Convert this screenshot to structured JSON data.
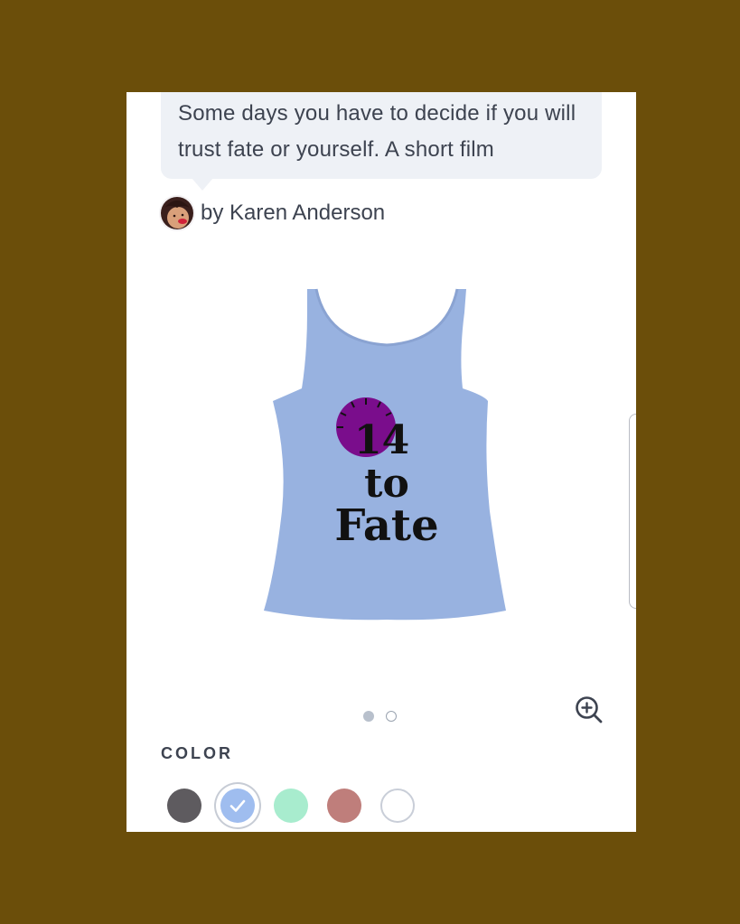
{
  "campaign": {
    "description": "Some days you have to decide if you will trust fate or yourself. A short film",
    "author_line": "by Karen Anderson"
  },
  "product": {
    "garment": "tank top",
    "garment_color": "#98b2e0",
    "print_lines": [
      "14",
      "to",
      "Fate"
    ],
    "clock_color": "#7a0d8c"
  },
  "gallery": {
    "total_images": 2,
    "active_index": 0
  },
  "zoom": {
    "icon": "zoom-in-icon"
  },
  "color_picker": {
    "label": "COLOR",
    "selected_index": 1,
    "swatches": [
      {
        "name": "Charcoal",
        "hex": "#5e5b5f"
      },
      {
        "name": "Blue Triblend",
        "hex": "#9fbdef"
      },
      {
        "name": "Mint",
        "hex": "#a8ecce"
      },
      {
        "name": "Rose",
        "hex": "#bf7e7b"
      },
      {
        "name": "White",
        "hex": "#ffffff"
      }
    ]
  }
}
